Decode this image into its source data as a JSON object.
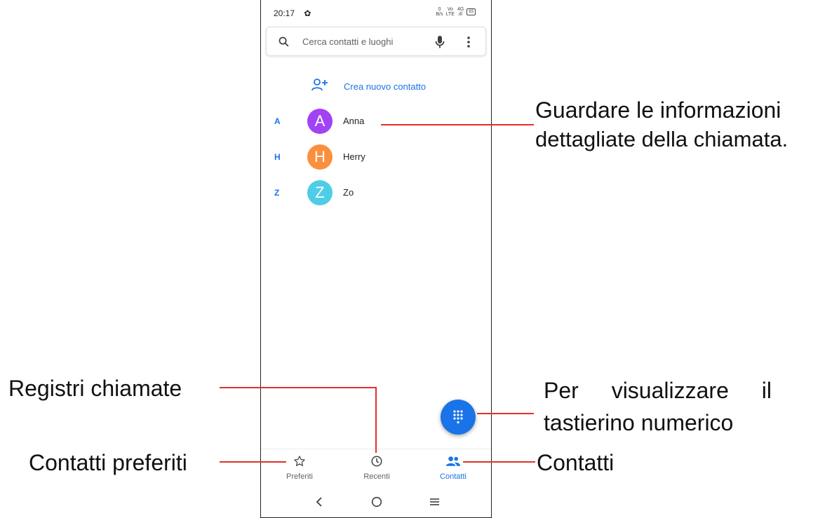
{
  "status_bar": {
    "time": "20:17",
    "net_speed_top": "0",
    "net_speed_bottom": "B/s",
    "volte_top": "Vo",
    "volte_bottom": "LTE",
    "signal": "4G",
    "battery": "83"
  },
  "search": {
    "placeholder": "Cerca contatti e luoghi"
  },
  "create_contact": {
    "label": "Crea nuovo contatto"
  },
  "contacts": [
    {
      "section": "A",
      "initial": "A",
      "name": "Anna",
      "color": "#a142f4"
    },
    {
      "section": "H",
      "initial": "H",
      "name": "Herry",
      "color": "#fa903e"
    },
    {
      "section": "Z",
      "initial": "Z",
      "name": "Zo",
      "color": "#4ecde6"
    }
  ],
  "bottom_nav": [
    {
      "label": "Preferiti",
      "icon": "star-outline-icon",
      "active": false
    },
    {
      "label": "Recenti",
      "icon": "clock-icon",
      "active": false
    },
    {
      "label": "Contatti",
      "icon": "people-icon",
      "active": true
    }
  ],
  "annotations": {
    "details_line1": "Guardare le informazioni",
    "details_line2": "dettagliate della chiamata.",
    "call_log": "Registri chiamate",
    "favorites": "Contatti preferiti",
    "keypad_line1": "Per visualizzare il",
    "keypad_line2": "tastierino numerico",
    "contacts": "Contatti"
  },
  "colors": {
    "accent": "#1a73e8",
    "callout_line": "#e0302e"
  }
}
